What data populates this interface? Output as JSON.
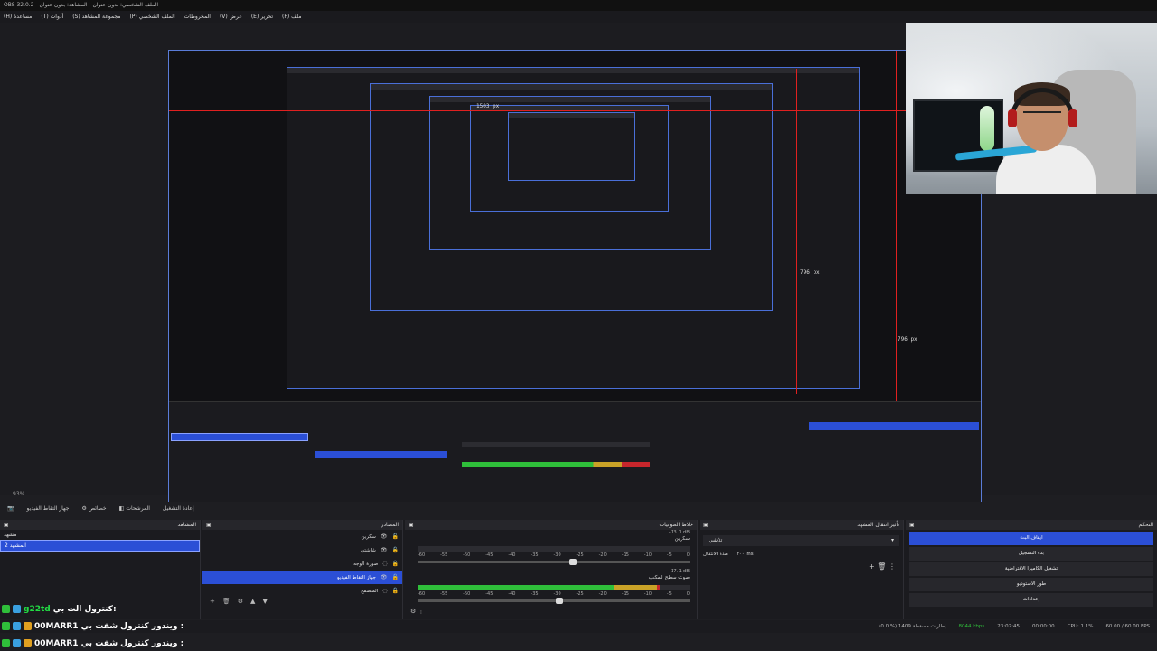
{
  "window": {
    "title": "OBS 32.0.2 - الملف الشخصي: بدون عنوان - المشاهد: بدون عنوان"
  },
  "menu": [
    "ملف (F)",
    "تحرير (E)",
    "عرض (V)",
    "المخروطات",
    "الملف الشخصي (P)",
    "مجموعة المشاهد (S)",
    "أدوات (T)",
    "مساعدة (H)"
  ],
  "preview": {
    "measure_width": "1503 px",
    "measure_height_inner": "796 px",
    "measure_height_outer": "796 px"
  },
  "toolbar": {
    "items": [
      "جهاز التقاط الفيديو",
      "خصائص",
      "المرشحات",
      "إعادة التشغيل"
    ],
    "zoom": "93%"
  },
  "scenes": {
    "title": "المشاهد",
    "items": [
      "مشهد",
      "المشهد 2"
    ],
    "selected_index": 1
  },
  "sources": {
    "title": "المصادر",
    "items": [
      "سكرين",
      "شاشتي",
      "صورة الوجه",
      "جهاز التقاط الفيديو",
      "المتصفح"
    ],
    "selected_index": 3
  },
  "mixer": {
    "title": "خلاط الصوتيات",
    "channels": [
      {
        "name": "سكرين",
        "db": "-13.1 dB",
        "level": 0.0,
        "fader": 0.57
      },
      {
        "name": "صوت سطح المكتب",
        "db": "-17.1 dB",
        "level": 0.89,
        "fader": 0.52
      }
    ],
    "ticks": [
      "-60",
      "-55",
      "-50",
      "-45",
      "-40",
      "-35",
      "-30",
      "-25",
      "-20",
      "-15",
      "-10",
      "-5",
      "0"
    ]
  },
  "transitions": {
    "title": "تأثير انتقال المشهد",
    "type": "تلاشي",
    "duration_label": "مدة الانتقال",
    "duration": "٣٠٠ ms"
  },
  "controls": {
    "title": "التحكم",
    "buttons": [
      "ايقاف البث",
      "بدء التسجيل",
      "تشغيل الكاميرا الافتراضية",
      "طور الاستوديو",
      "إعدادات"
    ]
  },
  "status": {
    "frames": "(0.0 %) 1409 إطارات مسقطة",
    "bitrate": "8044 kbps",
    "stream_time": "23:02:45",
    "rec_time": "00:00:00",
    "cpu": "CPU: 1.1%",
    "fps": "60.00 / 60.00 FPS"
  },
  "chat": [
    {
      "name": "g22td",
      "message": "كنترول الت بي:"
    },
    {
      "name": "00MARR1",
      "message": "ويندوز كنترول شفت بي :"
    },
    {
      "name": "00MARR1",
      "message": "ويندوز كنترول شفت بي :"
    }
  ],
  "colors": {
    "accent": "#2b4fd6",
    "measure_red": "#e02020",
    "meter_green": "#2fbf3a",
    "meter_yellow": "#c9a227",
    "meter_red": "#c7262c",
    "chat_name": "#22dd44"
  }
}
